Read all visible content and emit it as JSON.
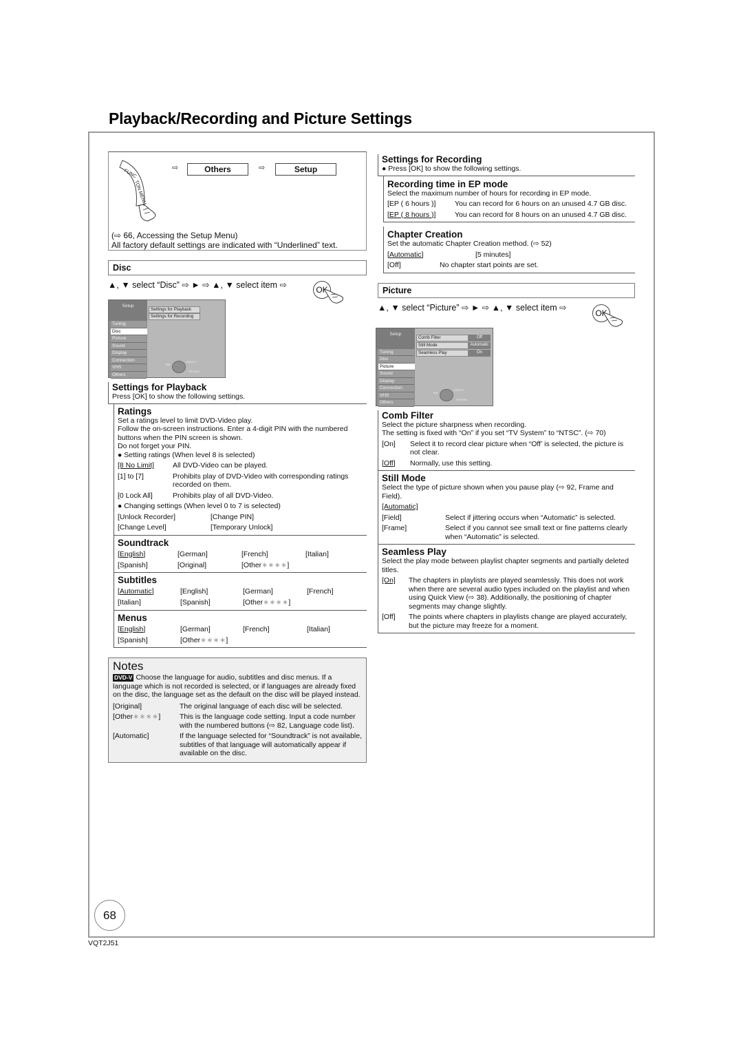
{
  "page": {
    "title": "Playback/Recording and Picture Settings",
    "page_number": "68",
    "doc_code": "VQT2J51"
  },
  "function_menu": {
    "ribbon_label": "FUNCTION MENU",
    "arrow": "⇨",
    "step1": "Others",
    "step2": "Setup",
    "reference": "(⇨ 66, Accessing the Setup Menu)",
    "note": "All factory default settings are indicated with “Underlined” text."
  },
  "disc": {
    "section_title": "Disc",
    "nav_instruction": "▲, ▼ select “Disc” ⇨ ► ⇨ ▲, ▼ select item ⇨",
    "ok_label": "OK",
    "screen": {
      "title": "Setup",
      "sidebar": [
        "Tuning",
        "Disc",
        "Picture",
        "Sound",
        "Display",
        "Connection",
        "VHS",
        "Others"
      ],
      "active": "Disc",
      "options": [
        "Settings for Playback",
        "Settings for Recording"
      ],
      "remote_labels": {
        "tab": "TAB",
        "select": "SELECT",
        "return": "RETURN"
      }
    }
  },
  "settings_for_playback": {
    "heading": "Settings for Playback",
    "desc": "Press [OK] to show the following settings.",
    "ratings": {
      "heading": "Ratings",
      "desc": [
        "Set a ratings level to limit DVD-Video play.",
        "Follow the on-screen instructions. Enter a 4-digit PIN with the numbered buttons when the PIN screen is shown.",
        "Do not forget your PIN."
      ],
      "bullet1": "Setting ratings (When level 8 is selected)",
      "options": [
        {
          "key": "[8 No Limit]",
          "default": true,
          "desc": "All DVD-Video can be played."
        },
        {
          "key": "[1] to [7]",
          "default": false,
          "desc": "Prohibits play of DVD-Video with corresponding ratings recorded on them."
        },
        {
          "key": "[0 Lock All]",
          "default": false,
          "desc": "Prohibits play of all DVD-Video."
        }
      ],
      "bullet2": "Changing settings (When level 0 to 7 is selected)",
      "change_options": [
        "[Unlock Recorder]",
        "[Change PIN]",
        "[Change Level]",
        "[Temporary Unlock]"
      ]
    },
    "soundtrack": {
      "heading": "Soundtrack",
      "options": [
        "English",
        "German",
        "French",
        "Italian",
        "Spanish",
        "Original",
        "Other"
      ],
      "default": "English"
    },
    "subtitles": {
      "heading": "Subtitles",
      "options": [
        "Automatic",
        "English",
        "German",
        "French",
        "Italian",
        "Spanish",
        "Other"
      ],
      "default": "Automatic"
    },
    "menus": {
      "heading": "Menus",
      "options": [
        "English",
        "German",
        "French",
        "Italian",
        "Spanish",
        "Other"
      ],
      "default": "English"
    },
    "other_stars": "∗∗∗∗"
  },
  "notes": {
    "title": "Notes",
    "badge": "DVD-V",
    "intro": "Choose the language for audio, subtitles and disc menus. If a language which is not recorded is selected, or if languages are already fixed on the disc, the language set as the default on the disc will be played instead.",
    "items": [
      {
        "key": "[Original]",
        "desc": "The original language of each disc will be selected."
      },
      {
        "key": "[Other",
        "key_suffix": "]",
        "desc": "This is the language code setting. Input a code number with the numbered buttons (⇨ 82, Language code list)."
      },
      {
        "key": "[Automatic]",
        "desc": "If the language selected for “Soundtrack” is not available, subtitles of that language will automatically appear if available on the disc."
      }
    ]
  },
  "settings_for_recording": {
    "heading": "Settings for Recording",
    "desc": "Press [OK] to show the following settings.",
    "ep_mode": {
      "heading": "Recording time in EP mode",
      "desc": "Select the maximum number of hours for recording in EP mode.",
      "options": [
        {
          "key": "[EP ( 6 hours )]",
          "default": false,
          "desc": "You can record for 6 hours on an unused 4.7 GB disc."
        },
        {
          "key": "[EP ( 8 hours )]",
          "default": true,
          "desc": "You can record for 8 hours on an unused 4.7 GB disc."
        }
      ]
    },
    "chapter_creation": {
      "heading": "Chapter Creation",
      "desc": "Set the automatic Chapter Creation method. (⇨ 52)",
      "opt_auto": "[Automatic]",
      "opt_5min": "[5 minutes]",
      "opt_off": "[Off]",
      "opt_off_desc": "No chapter start points are set."
    }
  },
  "picture": {
    "section_title": "Picture",
    "nav_instruction": "▲, ▼ select “Picture” ⇨ ► ⇨ ▲, ▼ select item ⇨",
    "ok_label": "OK",
    "screen": {
      "title": "Setup",
      "sidebar": [
        "Tuning",
        "Disc",
        "Picture",
        "Sound",
        "Display",
        "Connection",
        "VHS",
        "Others"
      ],
      "active": "Picture",
      "options": [
        {
          "label": "Comb Filter",
          "value": "Off"
        },
        {
          "label": "Still Mode",
          "value": "Automatic"
        },
        {
          "label": "Seamless Play",
          "value": "On"
        }
      ],
      "remote_labels": {
        "tab": "TAB",
        "select": "SELECT",
        "return": "RETURN"
      }
    },
    "comb_filter": {
      "heading": "Comb Filter",
      "desc": [
        "Select the picture sharpness when recording.",
        "The setting is fixed with “On” if you set “TV System” to “NTSC”. (⇨ 70)"
      ],
      "options": [
        {
          "key": "[On]",
          "default": false,
          "desc": "Select it to record clear picture when “Off’ is selected, the picture is not clear."
        },
        {
          "key": "[Off]",
          "default": true,
          "desc": "Normally, use this setting."
        }
      ]
    },
    "still_mode": {
      "heading": "Still Mode",
      "desc": "Select the type of picture shown when you pause play (⇨ 92, Frame and Field).",
      "default_option": "[Automatic]",
      "options": [
        {
          "key": "[Field]",
          "desc": "Select if jittering occurs when “Automatic” is selected."
        },
        {
          "key": "[Frame]",
          "desc": "Select if you cannot see small text or fine patterns clearly when “Automatic” is selected."
        }
      ]
    },
    "seamless_play": {
      "heading": "Seamless Play",
      "desc": "Select the play mode between playlist chapter segments and partially deleted titles.",
      "options": [
        {
          "key": "[On]",
          "default": true,
          "desc": "The chapters in playlists are played seamlessly. This does not work when there are several audio types included on the playlist and when using Quick View (⇨ 38). Additionally, the positioning of chapter segments may change slightly."
        },
        {
          "key": "[Off]",
          "default": false,
          "desc": "The points where chapters in playlists change are played accurately, but the picture may freeze for a moment."
        }
      ]
    }
  }
}
